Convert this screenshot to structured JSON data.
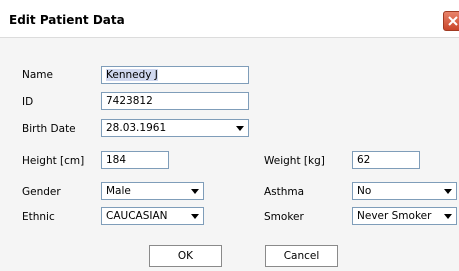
{
  "window": {
    "title": "Edit Patient Data"
  },
  "form": {
    "name": {
      "label": "Name",
      "value": "Kennedy J"
    },
    "id": {
      "label": "ID",
      "value": "7423812"
    },
    "birth_date": {
      "label": "Birth Date",
      "value": "28.03.1961"
    },
    "height": {
      "label": "Height [cm]",
      "value": "184"
    },
    "weight": {
      "label": "Weight [kg]",
      "value": "62"
    },
    "gender": {
      "label": "Gender",
      "value": "Male"
    },
    "asthma": {
      "label": "Asthma",
      "value": "No"
    },
    "ethnic": {
      "label": "Ethnic",
      "value": "CAUCASIAN"
    },
    "smoker": {
      "label": "Smoker",
      "value": "Never Smoker"
    }
  },
  "buttons": {
    "ok": "OK",
    "cancel": "Cancel"
  },
  "icons": {
    "close": "close-icon",
    "dropdown": "chevron-down-icon"
  },
  "colors": {
    "field_border": "#7f9db9",
    "close_button": "#d9573b",
    "selection": "#d0d8ef"
  }
}
